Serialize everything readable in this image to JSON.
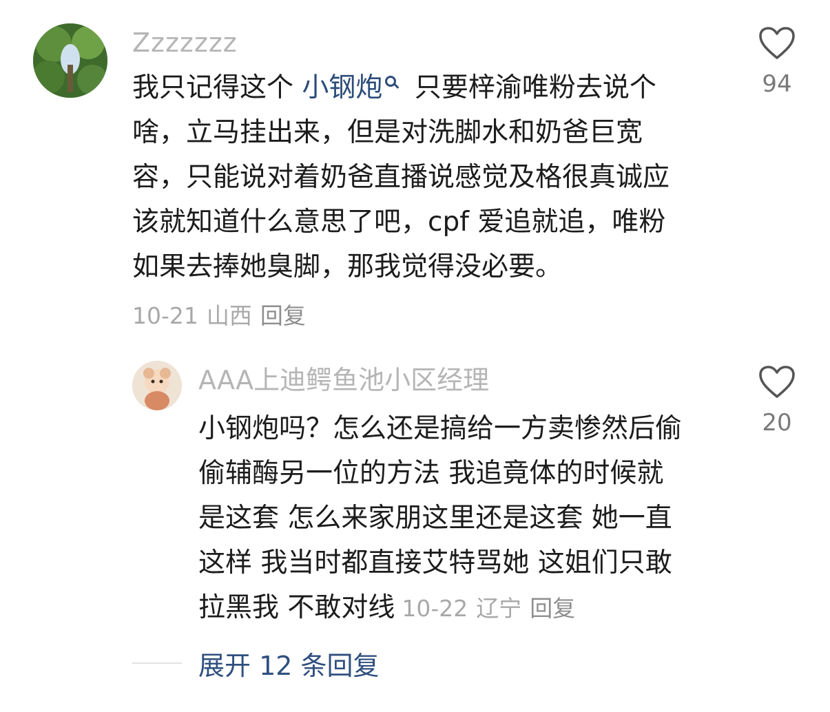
{
  "comment": {
    "username": "Zzzzzzz",
    "text_lines": [
      [
        "我只记得这个 ",
        "小钢炮",
        " 只要梓渝唯粉去说个"
      ],
      "啥，立马挂出来，但是对洗脚水和奶爸巨宽",
      "容，只能说对着奶爸直播说感觉及格很真诚应",
      "该就知道什么意思了吧，cpf 爱追就追，唯粉",
      "如果去捧她臭脚，那我觉得没必要。"
    ],
    "date": "10-21",
    "location": "山西",
    "reply_label": "回复",
    "like_count": "94",
    "mention_icon": "search-icon"
  },
  "reply": {
    "username": "AAA上迪鳄鱼池小区经理",
    "text_lines": [
      "小钢炮吗？怎么还是搞给一方卖惨然后偷",
      "偷辅酶另一位的方法 我追竟体的时候就",
      "是这套 怎么来家朋这里还是这套 她一直",
      "这样 我当时都直接艾特骂她 这姐们只敢",
      "拉黑我 不敢对线"
    ],
    "date": "10-22",
    "location": "辽宁",
    "reply_label": "回复",
    "like_count": "20"
  },
  "expand": {
    "label": "展开 12 条回复"
  },
  "colors": {
    "username": "#b5b5b5",
    "text": "#1c1c1c",
    "meta": "#a8a8a8",
    "link": "#2f4f7f"
  },
  "icons": {
    "like": "heart-icon"
  }
}
